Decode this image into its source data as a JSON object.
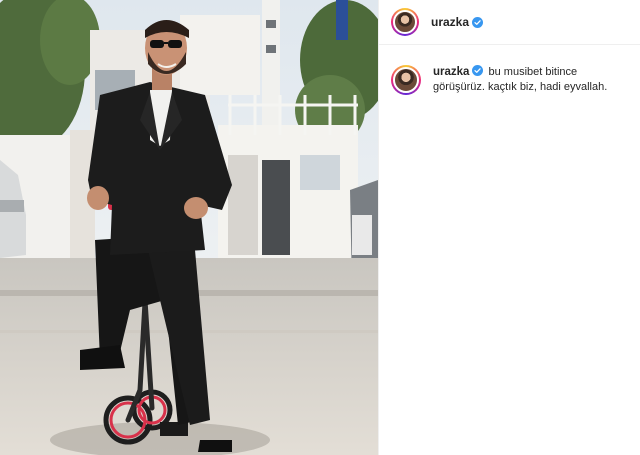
{
  "post": {
    "username": "urazka",
    "caption": "bu musibet bitince görüşürüz. kaçtık biz, hadi eyvallah."
  },
  "icons": {
    "verified": "verified-badge-icon",
    "avatar": "profile-avatar"
  },
  "colors": {
    "verified_blue": "#3897f0",
    "text": "#262626",
    "divider": "#efefef"
  }
}
